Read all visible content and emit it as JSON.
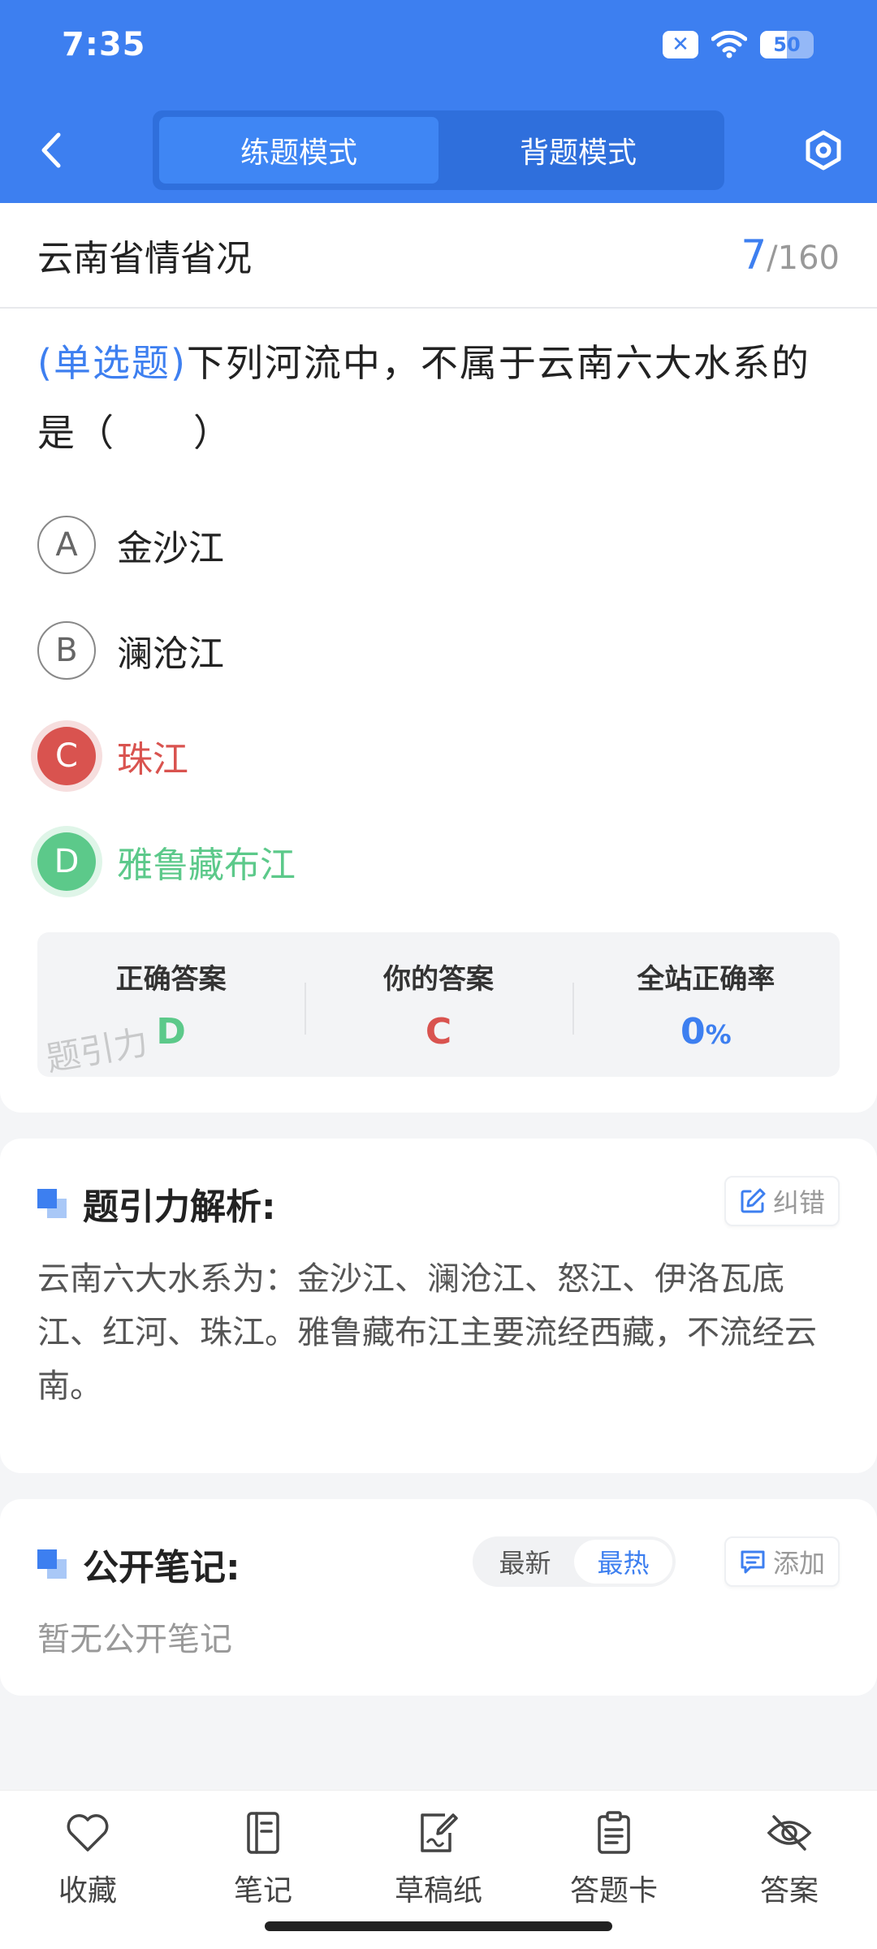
{
  "status_bar": {
    "time": "7:35",
    "battery": "50",
    "battery_level": 0.5
  },
  "header": {
    "tabs": [
      {
        "label": "练题模式",
        "active": true
      },
      {
        "label": "背题模式",
        "active": false
      }
    ],
    "back_icon": "chevron-left-icon",
    "settings_icon": "hexagon-settings-icon"
  },
  "question": {
    "chapter": "云南省情省况",
    "current": "7",
    "total": "/160",
    "type": "(单选题)",
    "text": "下列河流中，不属于云南六大水系的是（　　）",
    "options": [
      {
        "letter": "A",
        "text": "金沙江",
        "state": "normal"
      },
      {
        "letter": "B",
        "text": "澜沧江",
        "state": "normal"
      },
      {
        "letter": "C",
        "text": "珠江",
        "state": "wrong"
      },
      {
        "letter": "D",
        "text": "雅鲁藏布江",
        "state": "correct"
      }
    ],
    "result": {
      "correct_label": "正确答案",
      "correct_value": "D",
      "yours_label": "你的答案",
      "yours_value": "C",
      "rate_label": "全站正确率",
      "rate_value": "0",
      "rate_unit": "%"
    },
    "watermark": "题引力"
  },
  "analysis": {
    "title": "题引力解析:",
    "correct_button": "纠错",
    "body": "云南六大水系为：金沙江、澜沧江、怒江、伊洛瓦底江、红河、珠江。雅鲁藏布江主要流经西藏，不流经云南。"
  },
  "notes": {
    "title": "公开笔记:",
    "sort_options": [
      {
        "label": "最新",
        "active": false
      },
      {
        "label": "最热",
        "active": true
      }
    ],
    "add_button": "添加",
    "empty_text": "暂无公开笔记"
  },
  "bottom_nav": [
    {
      "label": "收藏",
      "icon": "heart-icon"
    },
    {
      "label": "笔记",
      "icon": "notebook-icon"
    },
    {
      "label": "草稿纸",
      "icon": "draft-paper-icon"
    },
    {
      "label": "答题卡",
      "icon": "answer-card-icon"
    },
    {
      "label": "答案",
      "icon": "eye-off-icon"
    }
  ],
  "colors": {
    "primary": "#3d7ff0",
    "wrong": "#d9534f",
    "correct": "#5cc98a"
  }
}
